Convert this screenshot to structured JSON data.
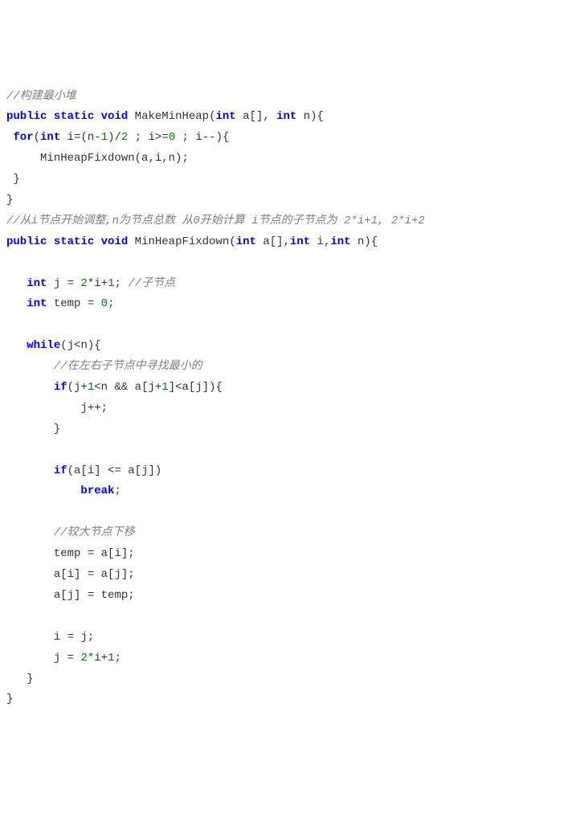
{
  "code": {
    "l0_c0": "//构建最小堆",
    "l1_k0": "public",
    "l1_k1": "static",
    "l1_k2": "void",
    "l1_fn": " MakeMinHeap(",
    "l1_k3": "int",
    "l1_a0": " a[], ",
    "l1_k4": "int",
    "l1_a1": " n){",
    "l2_sp": " ",
    "l2_k0": "for",
    "l2_p0": "(",
    "l2_k1": "int",
    "l2_t0": " i",
    "l2_op0": "=",
    "l2_t1": "(n",
    "l2_op1": "-",
    "l2_n0": "1",
    "l2_t2": ")",
    "l2_op2": "/",
    "l2_n1": "2",
    "l2_t3": " ; i",
    "l2_op3": ">=",
    "l2_n2": "0",
    "l2_t4": " ; i",
    "l2_op4": "--",
    "l2_t5": "){",
    "l3_sp": "     ",
    "l3_t0": "MinHeapFixdown(a,i,n);",
    "l4_t0": " }",
    "l5_t0": "}",
    "l6_c0": "//从i节点开始调整,n为节点总数 从0开始计算 i节点的子节点为 2*i+1, 2*i+2",
    "l7_k0": "public",
    "l7_k1": "static",
    "l7_k2": "void",
    "l7_fn": " MinHeapFixdown(",
    "l7_k3": "int",
    "l7_a0": " a[],",
    "l7_k4": "int",
    "l7_a1": " i,",
    "l7_k5": "int",
    "l7_a2": " n){",
    "l8_blank": "",
    "l9_sp": "   ",
    "l9_k0": "int",
    "l9_t0": " j ",
    "l9_op0": "=",
    "l9_sp1": " ",
    "l9_n0": "2",
    "l9_op1": "*",
    "l9_t1": "i",
    "l9_op2": "+",
    "l9_n1": "1",
    "l9_t2": "; ",
    "l9_c0": "//子节点",
    "l10_sp": "   ",
    "l10_k0": "int",
    "l10_t0": " temp ",
    "l10_op0": "=",
    "l10_sp1": " ",
    "l10_n0": "0",
    "l10_t1": ";",
    "l11_blank": "",
    "l12_sp": "   ",
    "l12_k0": "while",
    "l12_t0": "(j",
    "l12_op0": "<",
    "l12_t1": "n){",
    "l13_sp": "       ",
    "l13_c0": "//在左右子节点中寻找最小的",
    "l14_sp": "       ",
    "l14_k0": "if",
    "l14_t0": "(j",
    "l14_op0": "+",
    "l14_n0": "1",
    "l14_op1": "<",
    "l14_t1": "n ",
    "l14_op2": "&&",
    "l14_t2": " a[j",
    "l14_op3": "+",
    "l14_n1": "1",
    "l14_t3": "]",
    "l14_op4": "<",
    "l14_t4": "a[j]){",
    "l15_sp": "           ",
    "l15_t0": "j",
    "l15_op0": "++",
    "l15_t1": ";",
    "l16_sp": "       ",
    "l16_t0": "}",
    "l17_blank": "",
    "l18_sp": "       ",
    "l18_k0": "if",
    "l18_t0": "(a[i] ",
    "l18_op0": "<=",
    "l18_t1": " a[j])",
    "l19_sp": "           ",
    "l19_k0": "break",
    "l19_t0": ";",
    "l20_blank": "",
    "l21_sp": "       ",
    "l21_c0": "//较大节点下移",
    "l22_sp": "       ",
    "l22_t0": "temp ",
    "l22_op0": "=",
    "l22_t1": " a[i];",
    "l23_sp": "       ",
    "l23_t0": "a[i] ",
    "l23_op0": "=",
    "l23_t1": " a[j];",
    "l24_sp": "       ",
    "l24_t0": "a[j] ",
    "l24_op0": "=",
    "l24_t1": " temp;",
    "l25_blank": "",
    "l26_sp": "       ",
    "l26_t0": "i ",
    "l26_op0": "=",
    "l26_t1": " j;",
    "l27_sp": "       ",
    "l27_t0": "j ",
    "l27_op0": "=",
    "l27_sp1": " ",
    "l27_n0": "2",
    "l27_op1": "*",
    "l27_t1": "i",
    "l27_op2": "+",
    "l27_n1": "1",
    "l27_t2": ";",
    "l28_sp": "   ",
    "l28_t0": "}",
    "l29_t0": "}"
  }
}
